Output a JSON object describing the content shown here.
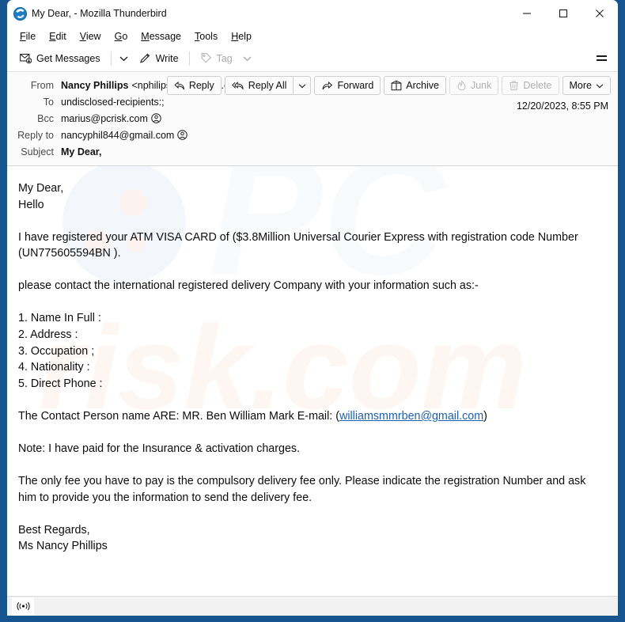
{
  "window": {
    "title": "My Dear, - Mozilla Thunderbird",
    "logo_icon": "thunderbird-logo-icon",
    "frame_color": "#15548f",
    "controls": {
      "minimize": "minimize-icon",
      "maximize": "maximize-icon",
      "close": "close-icon"
    }
  },
  "menubar": {
    "items": [
      {
        "label": "File",
        "accesskey": "F"
      },
      {
        "label": "Edit",
        "accesskey": "E"
      },
      {
        "label": "View",
        "accesskey": "V"
      },
      {
        "label": "Go",
        "accesskey": "G"
      },
      {
        "label": "Message",
        "accesskey": "M"
      },
      {
        "label": "Tools",
        "accesskey": "T"
      },
      {
        "label": "Help",
        "accesskey": "H"
      }
    ]
  },
  "toolbar": {
    "get_messages_label": "Get Messages",
    "get_messages_icon": "get-mail-icon",
    "get_messages_caret_icon": "chevron-down-icon",
    "write_label": "Write",
    "write_icon": "pencil-icon",
    "tag_label": "Tag",
    "tag_icon": "tag-icon",
    "tag_caret_icon": "chevron-down-icon",
    "tag_disabled": true,
    "app_menu_icon": "hamburger-menu-icon"
  },
  "message_header": {
    "rows": [
      {
        "label": "From",
        "name": "Nancy Phillips",
        "address": "<nphilips764@gmail.com>",
        "has_contact_icon": true
      },
      {
        "label": "To",
        "value": "undisclosed-recipients:;",
        "has_contact_icon": false
      },
      {
        "label": "Bcc",
        "value": "marius@pcrisk.com",
        "has_contact_icon": true
      },
      {
        "label": "Reply to",
        "value": "nancyphil844@gmail.com",
        "has_contact_icon": true
      },
      {
        "label": "Subject",
        "value": "My Dear,",
        "bold": true,
        "has_contact_icon": false
      }
    ],
    "date": "12/20/2023, 8:55 PM",
    "actions": [
      {
        "label": "Reply",
        "icon": "reply-icon",
        "disabled": false,
        "caret": false
      },
      {
        "label": "Reply All",
        "icon": "reply-all-icon",
        "disabled": false,
        "caret": true
      },
      {
        "label": "Forward",
        "icon": "forward-icon",
        "disabled": false,
        "caret": false
      },
      {
        "label": "Archive",
        "icon": "archive-box-icon",
        "disabled": false,
        "caret": false
      },
      {
        "label": "Junk",
        "icon": "junk-flame-icon",
        "disabled": true,
        "caret": false
      },
      {
        "label": "Delete",
        "icon": "trash-icon",
        "disabled": true,
        "caret": false
      },
      {
        "label": "More",
        "icon": "",
        "disabled": false,
        "caret": true
      }
    ]
  },
  "message_body": {
    "greeting_line_1": "My Dear,",
    "greeting_line_2": "Hello",
    "paragraph_1": "I have registered your ATM VISA CARD of ($3.8Million Universal Courier Express with registration code Number (UN775605594BN ).",
    "paragraph_2": "please contact the international registered delivery Company with your information such as:-",
    "list": [
      "1. Name In Full :",
      "2. Address :",
      "3. Occupation ;",
      "4. Nationality :",
      "5. Direct Phone :"
    ],
    "contact_prefix": "The Contact Person name ARE: MR. Ben William Mark   E-mail: (",
    "contact_email": "williamsmmrben@gmail.com",
    "contact_suffix": ")",
    "note": "Note: I have paid for the Insurance & activation charges.",
    "paragraph_3": "The only fee you have to pay is the compulsory delivery fee only. Please indicate the registration Number and ask him to provide you the information to send the delivery fee.",
    "signoff_line_1": "Best Regards,",
    "signoff_line_2": "Ms  Nancy Phillips",
    "link_color": "#1a5fb4"
  },
  "statusbar": {
    "connection_icon": "broadcast-online-icon"
  }
}
